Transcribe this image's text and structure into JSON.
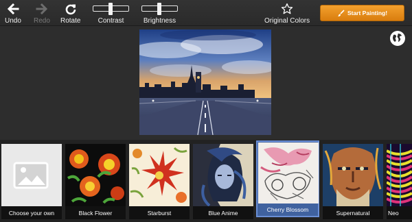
{
  "toolbar": {
    "undo": {
      "label": "Undo",
      "icon": "arrow-left-icon",
      "enabled": true
    },
    "redo": {
      "label": "Redo",
      "icon": "arrow-right-icon",
      "enabled": false
    },
    "rotate": {
      "label": "Rotate",
      "icon": "rotate-clockwise-icon",
      "enabled": true
    },
    "contrast": {
      "label": "Contrast",
      "value": 0.5
    },
    "brightness": {
      "label": "Brightness",
      "value": 0.5
    },
    "original_colors": {
      "label": "Original Colors",
      "icon": "star-outline-icon"
    },
    "start_button": {
      "label": "Start Painting!",
      "icon": "paintbrush-icon",
      "color": "#e58a16"
    }
  },
  "preview": {
    "icon": "london-street-photo"
  },
  "globe_button": {
    "icon": "globe-icon"
  },
  "styles": [
    {
      "label": "Choose your own",
      "icon": "image-placeholder-icon",
      "selected": false
    },
    {
      "label": "Black Flower",
      "icon": "black-flower-thumb",
      "selected": false
    },
    {
      "label": "Starburst",
      "icon": "starburst-thumb",
      "selected": false
    },
    {
      "label": "Blue Anime",
      "icon": "blue-anime-thumb",
      "selected": false
    },
    {
      "label": "Cherry Blossom",
      "icon": "cherry-blossom-thumb",
      "selected": true
    },
    {
      "label": "Supernatural",
      "icon": "supernatural-thumb",
      "selected": false
    },
    {
      "label": "Neo",
      "icon": "neon-thumb",
      "selected": false
    }
  ],
  "colors": {
    "selected_bg": "#40629f",
    "accent": "#e58a16"
  }
}
